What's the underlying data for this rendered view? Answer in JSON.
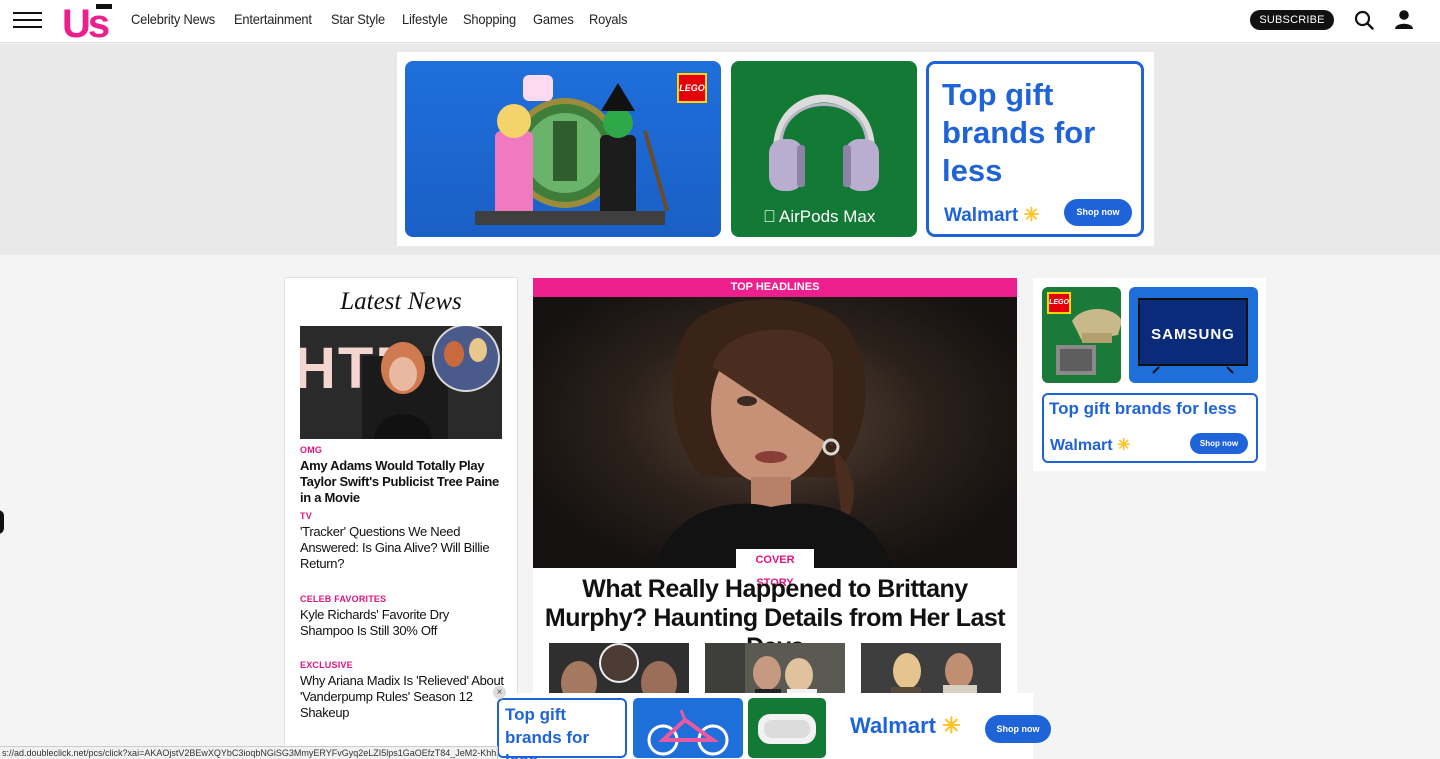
{
  "header": {
    "logo_text": "Us",
    "nav": [
      "Celebrity News",
      "Entertainment",
      "Star Style",
      "Lifestyle",
      "Shopping",
      "Games",
      "Royals"
    ],
    "subscribe_label": "SUBSCRIBE"
  },
  "top_ad": {
    "lego_badge": "LEGO",
    "airpods_label": "AirPods Max",
    "walmart_title": "Top gift brands for less",
    "walmart_brand": "Walmart",
    "shop_label": "Shop now"
  },
  "latest_news": {
    "title": "Latest News",
    "items": [
      {
        "category": "OMG",
        "title": "Amy Adams Would Totally Play Taylor Swift's Publicist Tree Paine in a Movie"
      },
      {
        "category": "TV",
        "title": "'Tracker' Questions We Need Answered: Is Gina Alive? Will Billie Return?"
      },
      {
        "category": "CELEB FAVORITES",
        "title": "Kyle Richards' Favorite Dry Shampoo Is Still 30% Off"
      },
      {
        "category": "EXCLUSIVE",
        "title": "Why Ariana Madix Is 'Relieved' About 'Vanderpump Rules' Season 12 Shakeup"
      }
    ]
  },
  "headline": {
    "bar_label": "TOP HEADLINES",
    "tag": "COVER STORY",
    "title": "What Really Happened to Brittany Murphy? Haunting Details from Her Last Days"
  },
  "right_ad": {
    "lego_badge": "LEGO",
    "samsung_label": "SAMSUNG",
    "walmart_title": "Top gift brands for less",
    "walmart_brand": "Walmart",
    "shop_label": "Shop now"
  },
  "bottom_ad": {
    "title": "Top gift brands for less",
    "walmart_brand": "Walmart",
    "shop_label": "Shop now",
    "close_symbol": "×"
  },
  "status_bar": {
    "url": "s://ad.doubleclick.net/pcs/click?xai=AKAOjstV2BEwXQYbC3ioqbNGiSG3MmyERYFvGyq2eLZI5lps1GaOEfzT84_JeM2-KhhX"
  },
  "colors": {
    "accent_pink": "#ec1f8c",
    "walmart_blue": "#1f63d8",
    "walmart_spark": "#ffc220"
  }
}
